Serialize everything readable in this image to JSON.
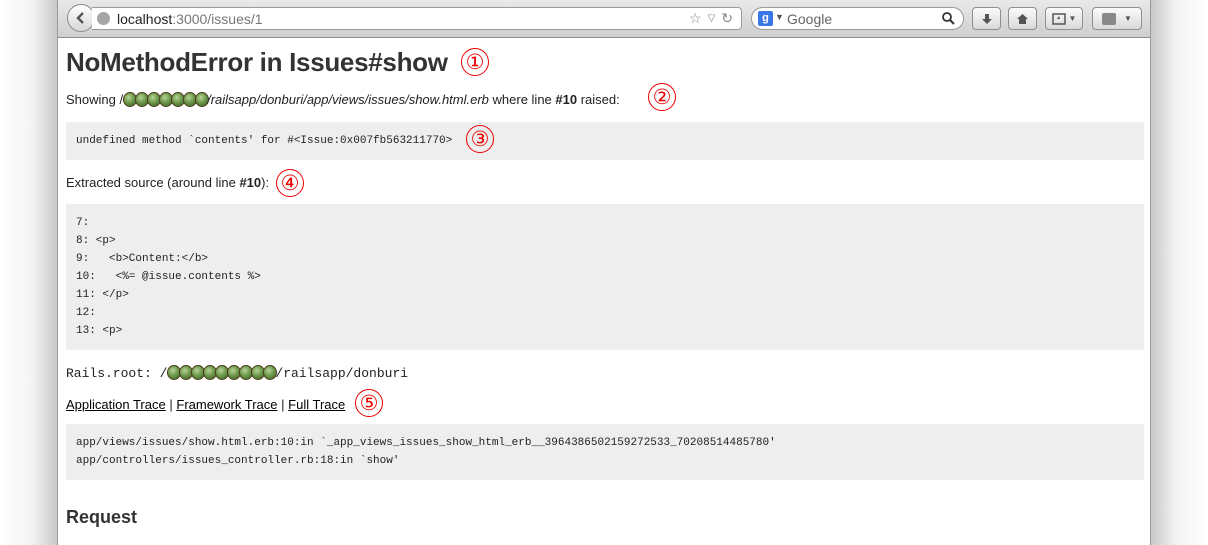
{
  "browser": {
    "url_host": "localhost",
    "url_path": ":3000/issues/1",
    "search_placeholder": "Google"
  },
  "error": {
    "title": "NoMethodError in Issues#show",
    "showing_prefix": "Showing /",
    "showing_path": "/railsapp/donburi/app/views/issues/show.html.erb",
    "where_line": " where line ",
    "line_number": "#10",
    "raised": " raised:",
    "message": "undefined method `contents' for #<Issue:0x007fb563211770>",
    "extracted_prefix": "Extracted source (around line ",
    "extracted_line": "#10",
    "extracted_suffix": "):"
  },
  "source_lines": [
    "7:",
    "8: <p>",
    "9:   <b>Content:</b>",
    "10:   <%= @issue.contents %>",
    "11: </p>",
    "12:",
    "13: <p>"
  ],
  "rails_root": {
    "prefix": "Rails.root: /",
    "suffix": "/railsapp/donburi"
  },
  "trace_links": {
    "application": "Application Trace",
    "framework": "Framework Trace",
    "full": "Full Trace",
    "separator": "|"
  },
  "trace_lines": [
    "app/views/issues/show.html.erb:10:in `_app_views_issues_show_html_erb__3964386502159272533_70208514485780'",
    "app/controllers/issues_controller.rb:18:in `show'"
  ],
  "request_heading": "Request",
  "annotations": [
    "①",
    "②",
    "③",
    "④",
    "⑤"
  ]
}
